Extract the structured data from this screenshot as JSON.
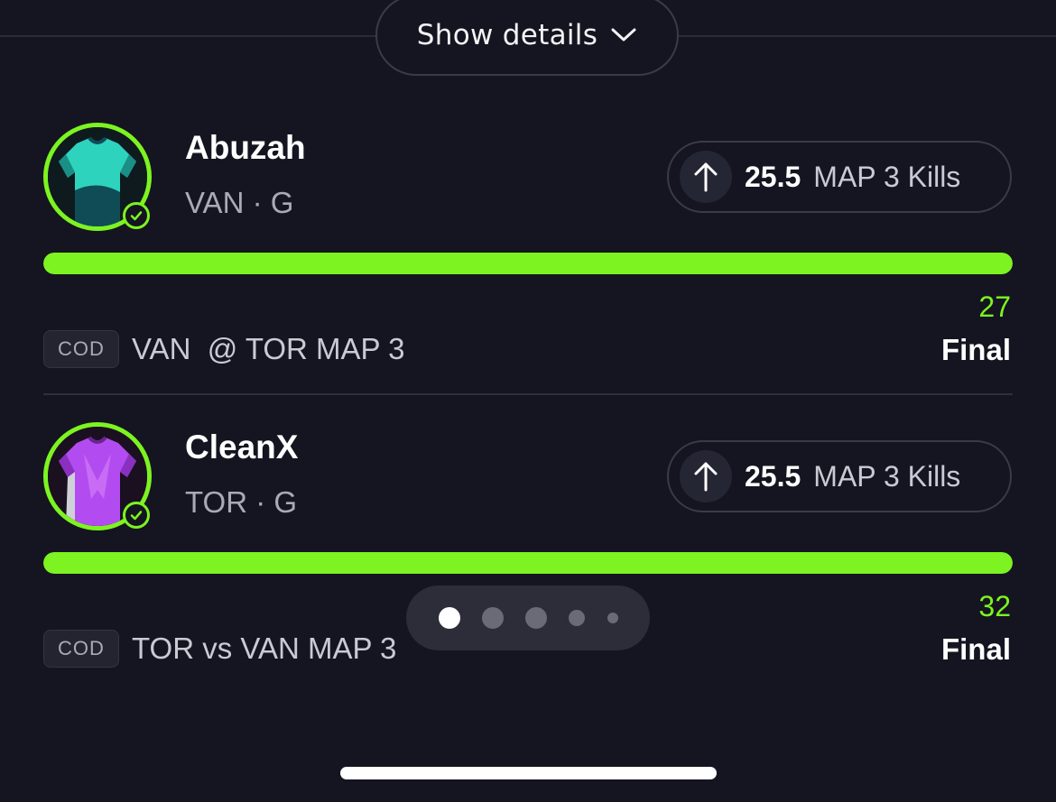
{
  "header": {
    "show_details_label": "Show details",
    "chevron_icon": "chevron-down-icon"
  },
  "colors": {
    "accent": "#7df321",
    "background": "#141520",
    "muted_text": "#a9aab7"
  },
  "picks": [
    {
      "player_name": "Abuzah",
      "player_meta": "VAN · G",
      "jersey_color": "#2ed3be",
      "direction_icon": "arrow-up-icon",
      "line": "25.5",
      "stat": "MAP 3 Kills",
      "progress_percent": 100,
      "result_value": "27",
      "result_status": "Final",
      "league": "COD",
      "matchup": "VAN  @ TOR MAP 3"
    },
    {
      "player_name": "CleanX",
      "player_meta": "TOR · G",
      "jersey_color": "#b34cf0",
      "direction_icon": "arrow-up-icon",
      "line": "25.5",
      "stat": "MAP 3 Kills",
      "progress_percent": 100,
      "result_value": "32",
      "result_status": "Final",
      "league": "COD",
      "matchup": "TOR vs VAN MAP 3"
    }
  ],
  "pager": {
    "total_dots": 5,
    "active_index": 0
  }
}
